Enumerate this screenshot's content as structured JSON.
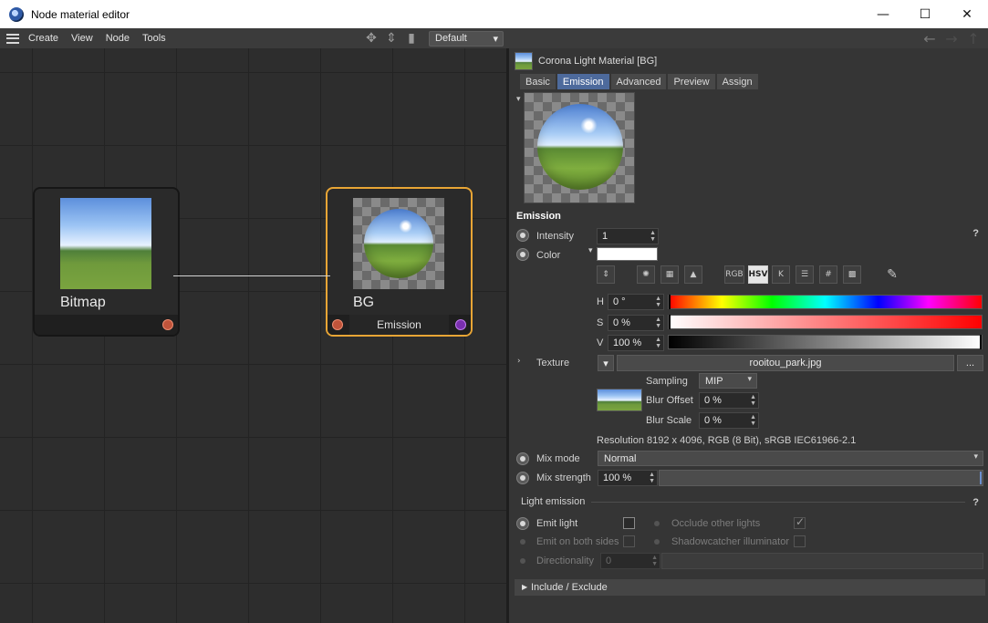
{
  "window": {
    "title": "Node material editor",
    "minimize_glyph": "—",
    "maximize_glyph": "☐",
    "close_glyph": "✕"
  },
  "menu": [
    "Create",
    "View",
    "Node",
    "Tools"
  ],
  "toolbar": {
    "layout_value": "Default"
  },
  "canvas": {
    "bitmap_node": {
      "title": "Bitmap"
    },
    "bg_node": {
      "title": "BG",
      "port_label": "Emission"
    }
  },
  "panel": {
    "material_title": "Corona Light Material [BG]",
    "tabs": [
      "Basic",
      "Emission",
      "Advanced",
      "Preview",
      "Assign"
    ],
    "active_tab": "Emission",
    "emission": {
      "section_title": "Emission",
      "help": "?",
      "intensity_label": "Intensity",
      "intensity_value": "1",
      "color_label": "Color",
      "color_value": "#ffffff",
      "h_label": "H",
      "h_value": "0 °",
      "s_label": "S",
      "s_value": "0 %",
      "v_label": "V",
      "v_value": "100 %",
      "texture_label": "Texture",
      "texture_file": "rooitou_park.jpg",
      "browse_label": "...",
      "sampling_label": "Sampling",
      "sampling_value": "MIP",
      "blur_offset_label": "Blur Offset",
      "blur_offset_value": "0 %",
      "blur_scale_label": "Blur Scale",
      "blur_scale_value": "0 %",
      "resolution_text": "Resolution 8192 x 4096, RGB (8 Bit), sRGB IEC61966-2.1",
      "mix_mode_label": "Mix mode",
      "mix_mode_value": "Normal",
      "mix_strength_label": "Mix strength",
      "mix_strength_value": "100 %"
    },
    "light_emission": {
      "section_title": "Light emission",
      "help": "?",
      "emit_light_label": "Emit light",
      "occlude_label": "Occlude other lights",
      "emit_both_sides_label": "Emit on both sides",
      "shadowcatcher_label": "Shadowcatcher illuminator",
      "directionality_label": "Directionality",
      "directionality_value": "0"
    },
    "include_exclude_label": "Include / Exclude",
    "color_tool_buttons": [
      "RGB",
      "HSV",
      "K",
      "#"
    ]
  }
}
